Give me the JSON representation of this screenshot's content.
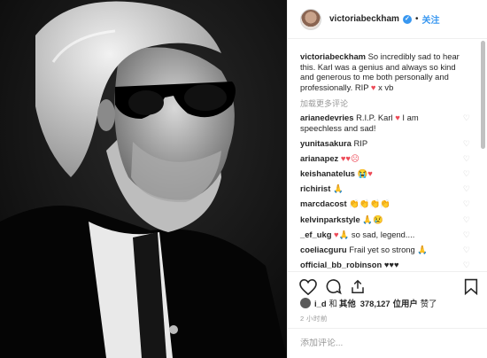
{
  "post": {
    "username": "victoriabeckham",
    "verified_mark": "✓",
    "separator": "•",
    "follow_label": "关注",
    "caption_user": "victoriabeckham",
    "caption_text": "So incredibly sad to hear this. Karl was a genius and always so kind and generous to me both personally and professionally. RIP",
    "caption_heart": "♥",
    "caption_tail": "x vb",
    "load_more": "加载更多评论",
    "comments": [
      {
        "user": "arianedevries",
        "text": "R.I.P. Karl",
        "emoji": "♥",
        "tail": "I am speechless and sad!"
      },
      {
        "user": "yunitasakura",
        "text": "RIP",
        "emoji": "",
        "tail": ""
      },
      {
        "user": "arianapez",
        "text": "",
        "emoji": "♥♥☹",
        "tail": ""
      },
      {
        "user": "keishanatelus",
        "text": "",
        "emoji": "😭♥",
        "tail": ""
      },
      {
        "user": "richirist",
        "text": "",
        "emoji": "🙏",
        "tail": ""
      },
      {
        "user": "marcdacost",
        "text": "",
        "emoji": "👏👏👏👏",
        "tail": ""
      },
      {
        "user": "kelvinparkstyle",
        "text": "",
        "emoji": "🙏😢",
        "tail": ""
      },
      {
        "user": "_ef_ukg",
        "text": "",
        "emoji": "♥🙏",
        "tail": "so sad, legend...."
      },
      {
        "user": "coeliacguru",
        "text": "Frail yet so strong",
        "emoji": "🙏",
        "tail": ""
      },
      {
        "user": "official_bb_robinson",
        "text": "",
        "emoji": "♥♥♥",
        "tail": ""
      }
    ],
    "likes": {
      "user": "i_d",
      "and": "和",
      "others": "其他",
      "count": "378,127",
      "suffix": "位用户",
      "liked": "赞了"
    },
    "date": "2 小时前",
    "add_comment_placeholder": "添加评论..."
  },
  "icons": {
    "like": "heart-outline-icon",
    "comment": "comment-icon",
    "share": "share-icon",
    "save": "bookmark-icon",
    "comment_like": "small-heart-icon"
  },
  "colors": {
    "accent": "#3897f0",
    "heart": "#ed4956",
    "muted": "#999999",
    "text": "#262626"
  }
}
